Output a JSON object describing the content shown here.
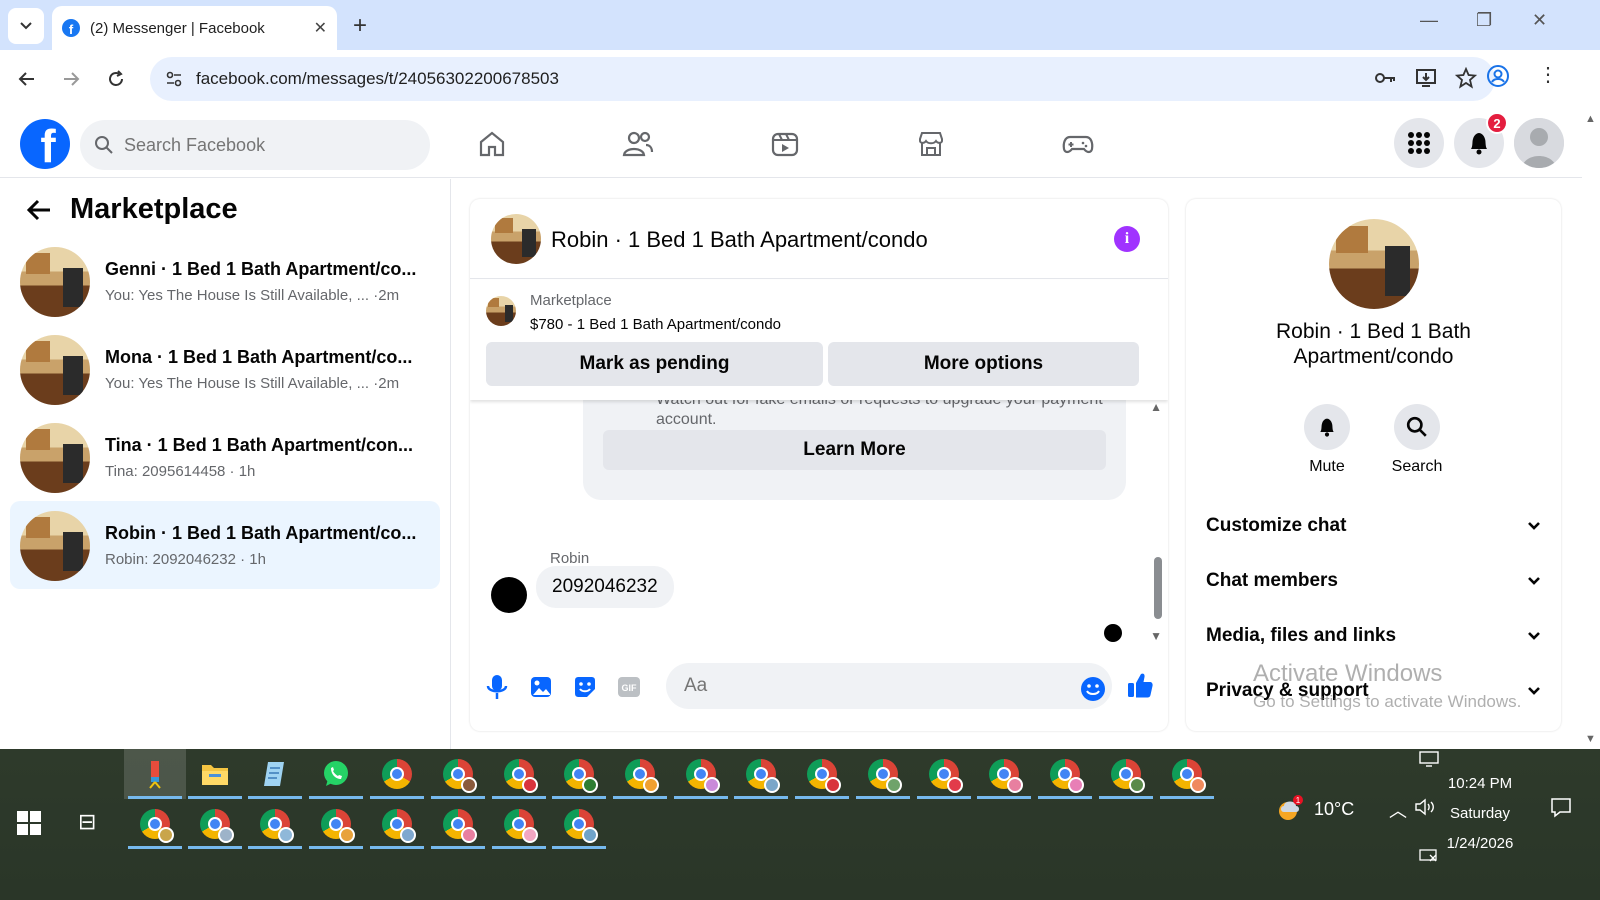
{
  "browser": {
    "tab_title": "(2) Messenger | Facebook",
    "url": "facebook.com/messages/t/24056302200678503"
  },
  "fb": {
    "search_placeholder": "Search Facebook",
    "notifications_badge": "2"
  },
  "left": {
    "title": "Marketplace",
    "conversations": [
      {
        "name": "Genni · 1 Bed 1 Bath Apartment/co...",
        "preview": "You: Yes The House Is Still Available, ...  ·2m",
        "active": false
      },
      {
        "name": "Mona · 1 Bed 1 Bath Apartment/co...",
        "preview": "You: Yes The House Is Still Available, ...  ·2m",
        "active": false
      },
      {
        "name": "Tina · 1 Bed 1 Bath Apartment/con...",
        "preview": "Tina: 2095614458 · 1h",
        "active": false
      },
      {
        "name": "Robin · 1 Bed 1 Bath Apartment/co...",
        "preview": "Robin: 2092046232 · 1h",
        "active": true
      }
    ]
  },
  "chat": {
    "title": "Robin · 1 Bed 1 Bath Apartment/condo",
    "marketplace_label": "Marketplace",
    "listing": "$780 - 1 Bed 1 Bath Apartment/condo",
    "mark_pending": "Mark as pending",
    "more_options": "More options",
    "notice_line1": "Watch out for fake emails or requests to upgrade your payment",
    "notice_line2": "account.",
    "learn_more": "Learn More",
    "sender": "Robin",
    "message": "2092046232",
    "composer_placeholder": "Aa"
  },
  "right": {
    "name": "Robin · 1 Bed 1 Bath Apartment/condo",
    "mute": "Mute",
    "search": "Search",
    "sections": [
      "Customize chat",
      "Chat members",
      "Media, files and links",
      "Privacy & support"
    ]
  },
  "watermark": {
    "line1": "Activate Windows",
    "line2": "Go to Settings to activate Windows."
  },
  "taskbar": {
    "temperature": "10°C",
    "time": "10:24 PM",
    "day": "Saturday",
    "date": "1/24/2026"
  },
  "colors": {
    "fb_blue": "#0866ff",
    "active_conv": "#ebf5ff",
    "info_purple": "#a033ff",
    "badge_red": "#e41e3f"
  }
}
